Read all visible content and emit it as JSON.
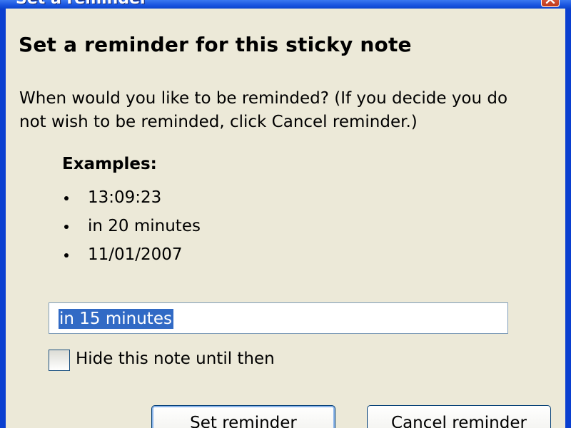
{
  "window": {
    "title": "Set a reminder"
  },
  "dialog": {
    "heading": "Set a reminder for this sticky note",
    "intro": "When would you like to be reminded?  (If you decide you do not wish to be reminded, click Cancel reminder.)",
    "examples_heading": "Examples:",
    "examples": [
      "13:09:23",
      "in 20 minutes",
      "11/01/2007"
    ],
    "reminder_input": {
      "value": "in 15 minutes"
    },
    "hide_checkbox": {
      "label": "Hide this note until then",
      "checked": false
    },
    "buttons": {
      "set_label": "Set reminder",
      "cancel_label": "Cancel reminder"
    }
  },
  "colors": {
    "titlebar": "#0a3fd0",
    "dialog_background": "#ece9d8",
    "selection": "#316ac5"
  }
}
